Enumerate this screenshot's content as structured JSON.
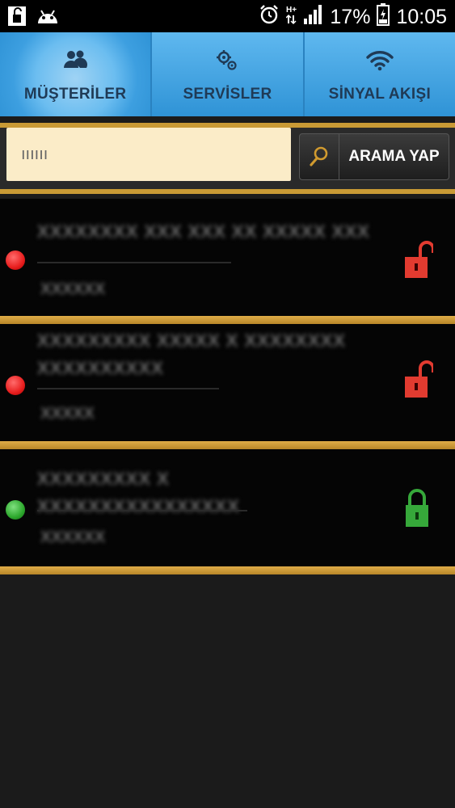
{
  "status_bar": {
    "left_icons": [
      "lock-notification-icon",
      "android-icon"
    ],
    "right_icons": [
      "alarm-icon",
      "hplus-network-icon",
      "signal-icon",
      "battery-charging-icon"
    ],
    "battery": "17%",
    "time": "10:05"
  },
  "tabs": [
    {
      "label": "MÜŞTERİLER",
      "icon": "users-icon",
      "active": true
    },
    {
      "label": "SERVİSLER",
      "icon": "gears-icon",
      "active": false
    },
    {
      "label": "SİNYAL AKIŞI",
      "icon": "wifi-icon",
      "active": false
    }
  ],
  "search": {
    "value": "ıııııı",
    "button_label": "ARAMA YAP",
    "button_icon": "search-icon"
  },
  "customers": [
    {
      "title": "XXXXXXXX XXX XXX XX XXXXX XXX",
      "subtitle": "XXXXXX",
      "status": "red",
      "lock": "unlocked"
    },
    {
      "title": "XXXXXXXXX XXXXX X XXXXXXXX XXXXXXXXXX",
      "subtitle": "XXXXX",
      "status": "red",
      "lock": "unlocked"
    },
    {
      "title": "XXXXXXXXX X XXXXXXXXXXXXXXXX",
      "subtitle": "XXXXXX",
      "status": "green",
      "lock": "locked"
    }
  ],
  "colors": {
    "tab_blue": "#2f93d6",
    "gold_border": "#c99a35",
    "status_red": "#e81e1e",
    "status_green": "#2da82d",
    "lock_red": "#e23b30",
    "lock_green": "#36a83a"
  }
}
